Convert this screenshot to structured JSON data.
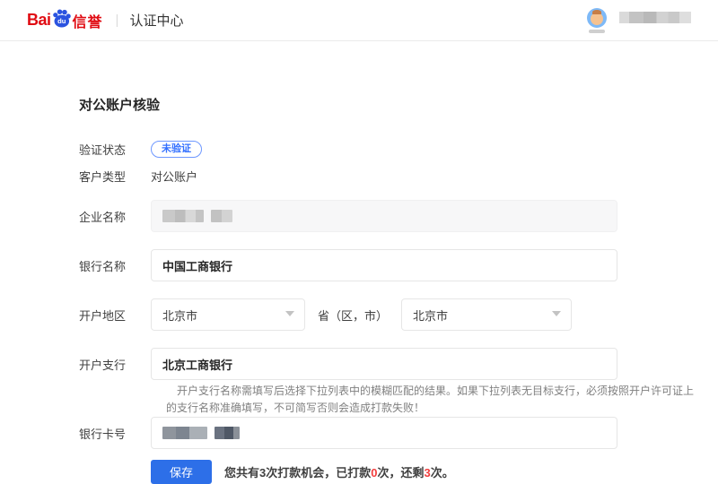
{
  "header": {
    "logo": {
      "bai": "Bai",
      "du": "du",
      "name": "信誉"
    },
    "divider": "|",
    "nav_title": "认证中心",
    "user": {
      "avatar_icon": "user-avatar",
      "name_redacted": true
    }
  },
  "page": {
    "title": "对公账户核验"
  },
  "form": {
    "status": {
      "label": "验证状态",
      "badge": "未验证"
    },
    "customer_type": {
      "label": "客户类型",
      "value": "对公账户"
    },
    "company_name": {
      "label": "企业名称",
      "value_redacted": true,
      "disabled": true
    },
    "bank_name": {
      "label": "银行名称",
      "value": "中国工商银行"
    },
    "region": {
      "label": "开户地区",
      "city_value": "北京市",
      "province_label": "省（区，市）",
      "province_value": "北京市"
    },
    "branch": {
      "label": "开户支行",
      "value": "北京工商银行",
      "help": "开户支行名称需填写后选择下拉列表中的模糊匹配的结果。如果下拉列表无目标支行，必须按照开户许可证上的支行名称准确填写，不可简写否则会造成打款失败！"
    },
    "card_number": {
      "label": "银行卡号",
      "value_redacted": true
    },
    "actions": {
      "save_label": "保存",
      "note": {
        "part1": "您共有3次打款机会，已打款",
        "paid": "0",
        "part2": "次，还剩",
        "remaining": "3",
        "part3": "次。"
      }
    }
  },
  "colors": {
    "brand_red": "#e00b12",
    "paw_blue": "#2b53e0",
    "badge_blue": "#3370ff",
    "button_blue": "#2d6fe8",
    "alert_red": "#f23d3d"
  }
}
